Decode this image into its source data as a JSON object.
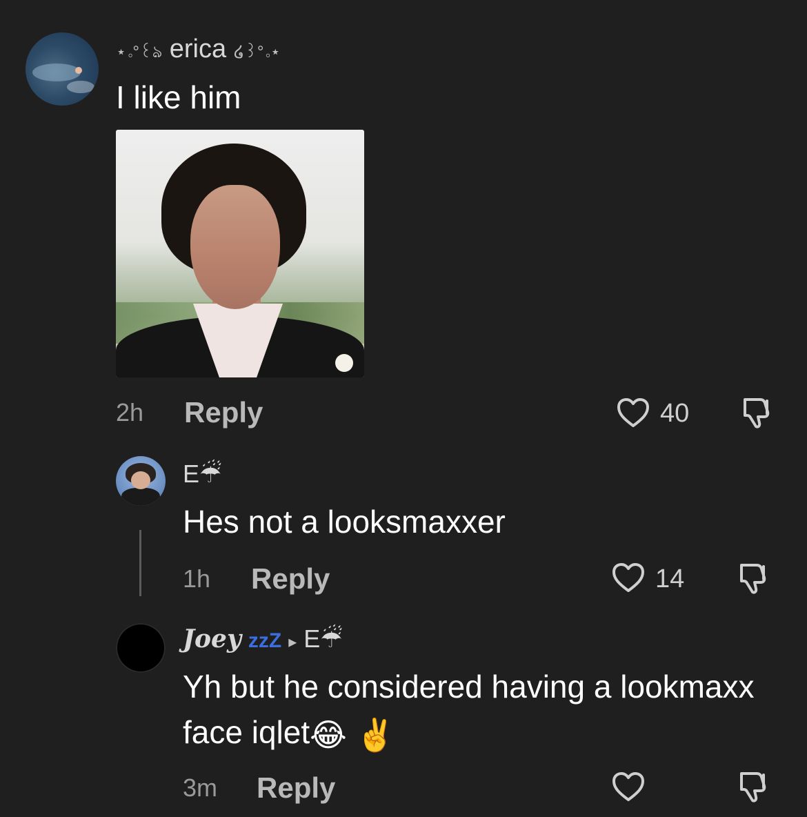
{
  "comment_main": {
    "username_prefix": "⋆｡°꒰ঌ",
    "username": "erica",
    "username_suffix": "໒꒱°｡⋆",
    "text": "I like him",
    "time": "2h",
    "reply_label": "Reply",
    "like_count": "40"
  },
  "reply_e": {
    "username": "E☔",
    "text": "Hes not a looksmaxxer",
    "time": "1h",
    "reply_label": "Reply",
    "like_count": "14"
  },
  "reply_joey": {
    "username": "Joey",
    "zzz": "zzZ",
    "arrow": "▸",
    "reply_to": "E☔",
    "text": "Yh but he considered having a lookmaxx face iqlet",
    "emoji_1": "😂",
    "emoji_2": "✌️",
    "time": "3m",
    "reply_label": "Reply"
  },
  "colors": {
    "background": "#1f1f1f",
    "text_primary": "#ffffff",
    "text_secondary": "#9a9a9a",
    "zzz_blue": "#3b6fe0"
  },
  "icons": {
    "like": "heart-icon",
    "dislike": "thumbs-down-icon"
  }
}
